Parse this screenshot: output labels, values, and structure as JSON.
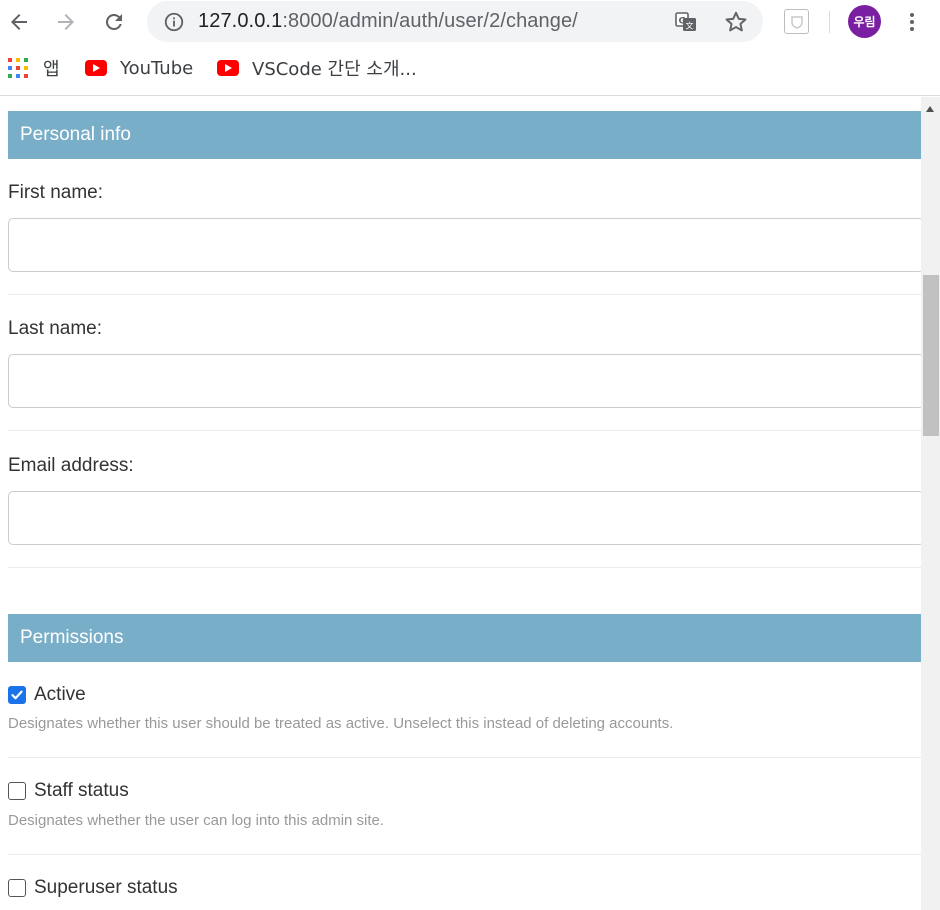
{
  "browser": {
    "url_host": "127.0.0.1",
    "url_rest": ":8000/admin/auth/user/2/change/",
    "profile_label": "우림",
    "bookmarks": [
      {
        "label": "앱",
        "icon": "apps-grid-icon"
      },
      {
        "label": "YouTube",
        "icon": "youtube-icon"
      },
      {
        "label": "VSCode 간단 소개...",
        "icon": "youtube-icon"
      }
    ]
  },
  "personal_info": {
    "title": "Personal info",
    "fields": [
      {
        "label": "First name:",
        "value": ""
      },
      {
        "label": "Last name:",
        "value": ""
      },
      {
        "label": "Email address:",
        "value": ""
      }
    ]
  },
  "permissions": {
    "title": "Permissions",
    "items": [
      {
        "label": "Active",
        "checked": true,
        "help": "Designates whether this user should be treated as active. Unselect this instead of deleting accounts."
      },
      {
        "label": "Staff status",
        "checked": false,
        "help": "Designates whether the user can log into this admin site."
      },
      {
        "label": "Superuser status",
        "checked": false,
        "help": ""
      }
    ]
  },
  "colors": {
    "fieldset_header": "#79aec8",
    "checkbox_checked": "#1a73e8",
    "avatar": "#7b1fa2"
  }
}
